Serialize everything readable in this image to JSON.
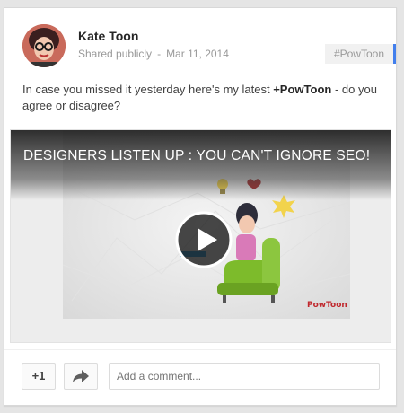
{
  "post": {
    "author_name": "Kate Toon",
    "visibility": "Shared publicly",
    "separator": "-",
    "date": "Mar 11, 2014",
    "hashtag": "#PowToon",
    "text_before": "In case you missed it yesterday here's my latest ",
    "text_mention": "+PowToon",
    "text_after": " - do you agree or disagree?"
  },
  "video": {
    "title": "DESIGNERS LISTEN UP : YOU CAN'T IGNORE SEO!",
    "logo_text": "PowToon"
  },
  "actions": {
    "plus_one_label": "+1",
    "comment_placeholder": "Add a comment..."
  },
  "icons": [
    "avatar",
    "play-icon",
    "share-icon",
    "lightbulb-icon",
    "heart-icon",
    "star-burst-icon"
  ],
  "colors": {
    "hashtag_accent": "#427fed",
    "author": "#262626",
    "meta": "#999999"
  }
}
